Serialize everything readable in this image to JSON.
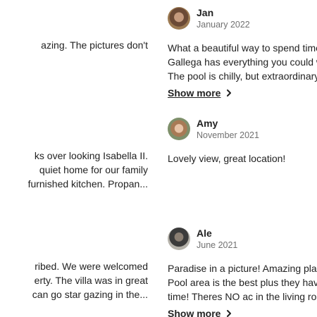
{
  "left_reviews": [
    {
      "lines": [
        "azing. The pictures don't"
      ]
    },
    {
      "lines": [
        "ks over looking Isabella II.",
        "quiet home for our family",
        "furnished kitchen. Propan..."
      ]
    },
    {
      "lines": [
        "ribed. We were welcomed",
        "erty. The villa was in great",
        "can go star gazing in the..."
      ]
    }
  ],
  "right_reviews": [
    {
      "name": "Jan",
      "date": "January 2022",
      "lines": [
        "What a beautiful way to spend time o",
        "Gallega has everything you could wa",
        "The pool is chilly, but extraordinary, a"
      ],
      "show_more": "Show more"
    },
    {
      "name": "Amy",
      "date": "November 2021",
      "lines": [
        "Lovely view, great location!"
      ]
    },
    {
      "name": "Ale",
      "date": "June 2021",
      "lines": [
        "Paradise in a picture! Amazing place!",
        "Pool area is the best plus they have a",
        "time! Theres NO ac in the living room"
      ],
      "show_more": "Show more"
    }
  ],
  "icons": {
    "show_more": "chevron-right-icon"
  },
  "colors": {
    "text": "#222222",
    "secondary_text": "#717171",
    "background": "#ffffff"
  }
}
